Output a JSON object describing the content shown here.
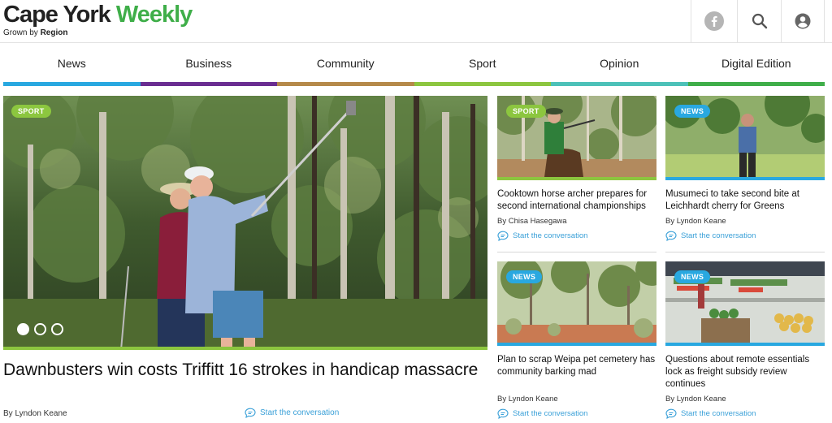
{
  "logo": {
    "part1": "Cape York",
    "part2": "Weekly",
    "tagline_prefix": "Grown by",
    "tagline_bold": "Region"
  },
  "header_icons": [
    "facebook-icon",
    "search-icon",
    "user-account-icon"
  ],
  "nav": {
    "items": [
      {
        "label": "News",
        "color": "#29a8e0"
      },
      {
        "label": "Business",
        "color": "#6a2d91"
      },
      {
        "label": "Community",
        "color": "#b5894a"
      },
      {
        "label": "Sport",
        "color": "#8cc63f"
      },
      {
        "label": "Opinion",
        "color": "#4cc1b8"
      },
      {
        "label": "Digital Edition",
        "color": "#3fae49"
      }
    ]
  },
  "hero": {
    "badge": "SPORT",
    "title": "Dawnbusters win costs Triffitt 16 strokes in handicap massacre",
    "byline": "By Lyndon Keane",
    "convo": "Start the conversation",
    "slide_count": 3,
    "active_slide": 1
  },
  "cards": [
    {
      "badge": "SPORT",
      "title": "Cooktown horse archer prepares for second international championships",
      "byline": "By Chisa Hasegawa",
      "convo": "Start the conversation"
    },
    {
      "badge": "NEWS",
      "title": "Musumeci to take second bite at Leichhardt cherry for Greens",
      "byline": "By Lyndon Keane",
      "convo": "Start the conversation"
    },
    {
      "badge": "NEWS",
      "title": "Plan to scrap Weipa pet cemetery has community barking mad",
      "byline": "By Lyndon Keane",
      "convo": "Start the conversation"
    },
    {
      "badge": "NEWS",
      "title": "Questions about remote essentials lock as freight subsidy review continues",
      "byline": "By Lyndon Keane",
      "convo": "Start the conversation"
    }
  ],
  "colors": {
    "brand_green": "#3fae49",
    "sport_green": "#8cc63f",
    "news_blue": "#29a8e0",
    "link_blue": "#3aa0d8"
  }
}
